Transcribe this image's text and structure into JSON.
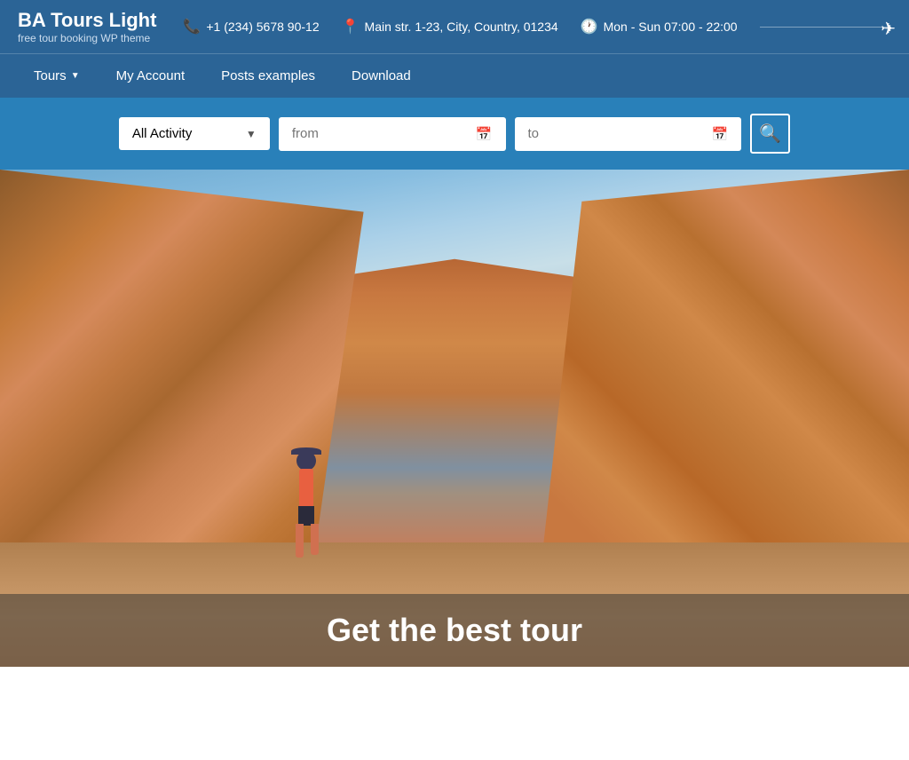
{
  "site": {
    "title": "BA Tours Light",
    "subtitle": "free tour booking WP theme"
  },
  "header": {
    "phone_icon": "📞",
    "phone": "+1 (234) 5678 90-12",
    "location_icon": "📍",
    "address": "Main str. 1-23, City, Country, 01234",
    "clock_icon": "🕐",
    "hours": "Mon - Sun 07:00 - 22:00",
    "plane_icon": "✈"
  },
  "nav": {
    "items": [
      {
        "label": "Tours",
        "has_dropdown": true
      },
      {
        "label": "My Account",
        "has_dropdown": false
      },
      {
        "label": "Posts examples",
        "has_dropdown": false
      },
      {
        "label": "Download",
        "has_dropdown": false
      }
    ]
  },
  "search": {
    "activity_label": "All Activity",
    "activity_chevron": "▼",
    "from_placeholder": "from",
    "to_placeholder": "to",
    "calendar_icon": "📅",
    "search_icon": "🔍"
  },
  "hero": {
    "caption": "Get the best tour"
  }
}
